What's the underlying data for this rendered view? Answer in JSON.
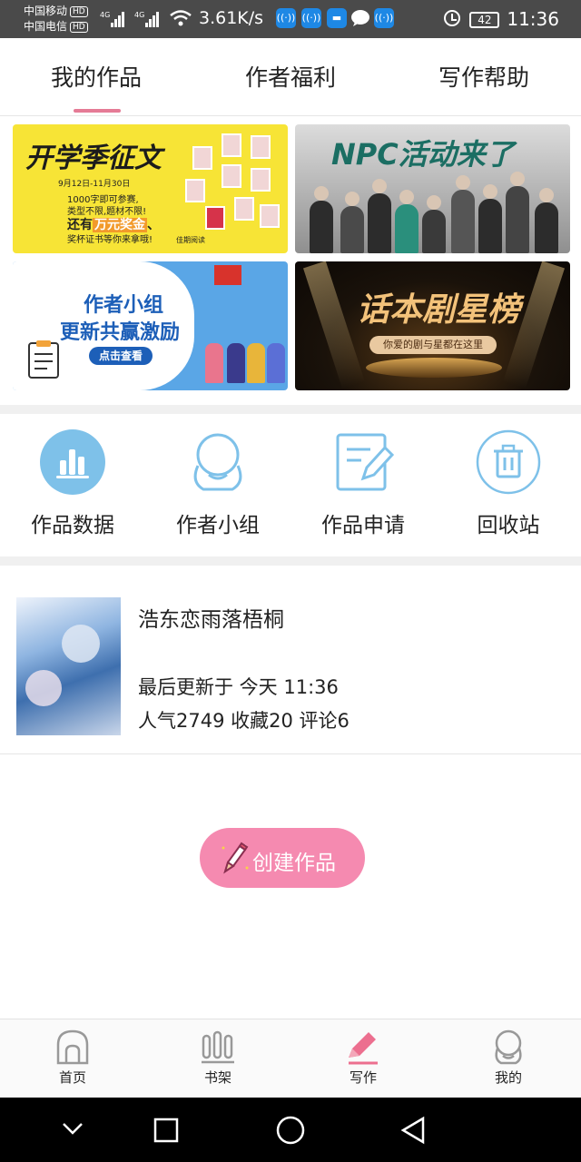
{
  "status_bar": {
    "carrier1": "中国移动",
    "carrier2": "中国电信",
    "hd_label": "HD",
    "net1": "4G",
    "net2": "4G",
    "speed": "3.61K/s",
    "battery": "42",
    "time": "11:36"
  },
  "tabs": [
    "我的作品",
    "作者福利",
    "写作帮助"
  ],
  "active_tab": 0,
  "banners": {
    "b1": {
      "title": "开学季征文",
      "date": "9月12日-11月30日",
      "line1": "1000字即可参赛,",
      "line2": "类型不限,题材不限!",
      "prize_prefix": "还有",
      "prize_highlight": "万元奖金",
      "prize_suffix": "、",
      "line3": "奖杯证书等你来拿哦!",
      "brand": "佳期阅读"
    },
    "b2": {
      "title": "NPC活动来了"
    },
    "b3": {
      "title1": "作者小组",
      "title2": "更新共赢激励",
      "button": "点击查看"
    },
    "b4": {
      "title": "话本剧星榜",
      "subtitle": "你爱的剧与星都在这里"
    }
  },
  "actions": [
    {
      "label": "作品数据",
      "icon": "bar-chart-icon"
    },
    {
      "label": "作者小组",
      "icon": "group-icon"
    },
    {
      "label": "作品申请",
      "icon": "document-edit-icon"
    },
    {
      "label": "回收站",
      "icon": "trash-icon"
    }
  ],
  "work": {
    "title": "浩东恋雨落梧桐",
    "updated": "最后更新于 今天 11:36",
    "stats": "人气2749 收藏20 评论6"
  },
  "create_button": "创建作品",
  "bottom_nav": [
    {
      "label": "首页",
      "icon": "home-icon"
    },
    {
      "label": "书架",
      "icon": "bookshelf-icon"
    },
    {
      "label": "写作",
      "icon": "pen-icon"
    },
    {
      "label": "我的",
      "icon": "profile-icon"
    }
  ],
  "active_nav": 2,
  "colors": {
    "accent_pink": "#e57b96",
    "create_button": "#f58ab0",
    "icon_blue": "#7ec1e9"
  }
}
